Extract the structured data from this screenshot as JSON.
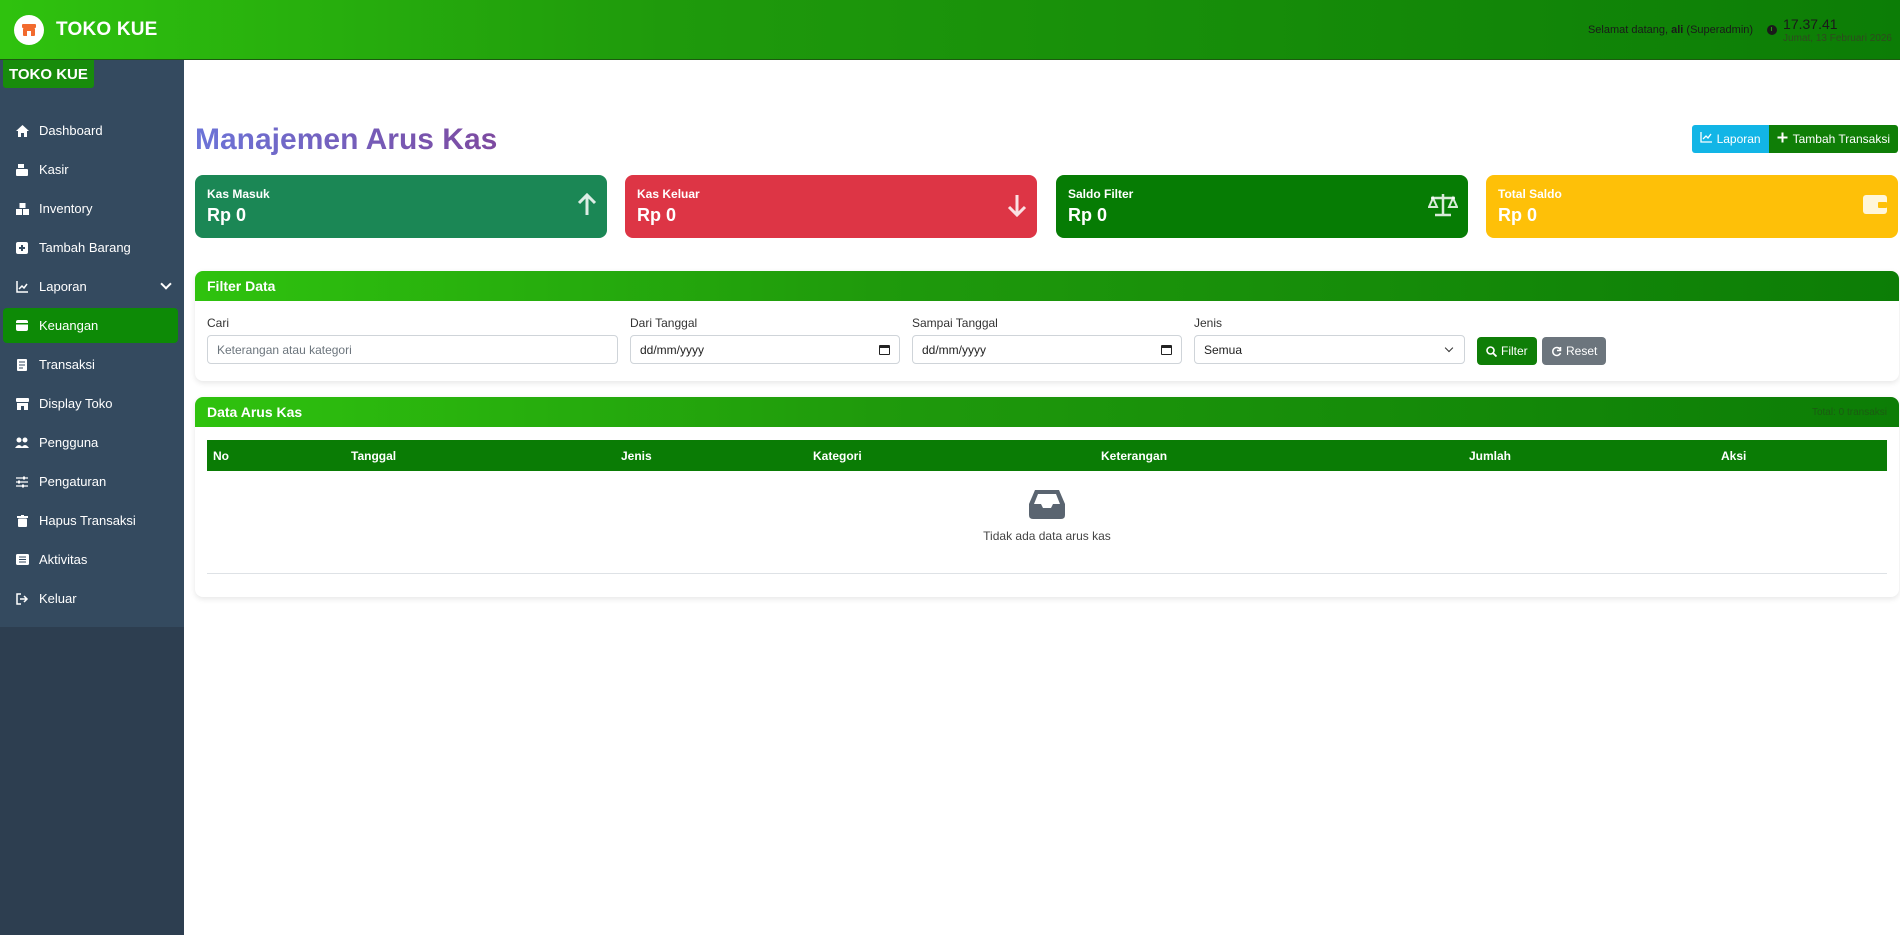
{
  "app": {
    "brand": "TOKO KUE",
    "sidebar_brand": "TOKO KUE"
  },
  "header": {
    "welcome_prefix": "Selamat datang, ",
    "user": "ali",
    "role": "(Superadmin)",
    "time": "17.37.41",
    "date": "Jumat, 13 Februari 2026"
  },
  "sidebar": {
    "items": [
      {
        "label": "Dashboard",
        "icon": "home-icon"
      },
      {
        "label": "Kasir",
        "icon": "cash-register-icon"
      },
      {
        "label": "Inventory",
        "icon": "boxes-icon"
      },
      {
        "label": "Tambah Barang",
        "icon": "plus-square-icon"
      },
      {
        "label": "Laporan",
        "icon": "chart-line-icon"
      },
      {
        "label": "Keuangan",
        "icon": "wallet-icon"
      },
      {
        "label": "Transaksi",
        "icon": "receipt-icon"
      },
      {
        "label": "Display Toko",
        "icon": "store-icon"
      },
      {
        "label": "Pengguna",
        "icon": "users-icon"
      },
      {
        "label": "Pengaturan",
        "icon": "sliders-icon"
      },
      {
        "label": "Hapus Transaksi",
        "icon": "trash-icon"
      },
      {
        "label": "Aktivitas",
        "icon": "list-icon"
      },
      {
        "label": "Keluar",
        "icon": "sign-out-icon"
      }
    ],
    "active": "Keuangan"
  },
  "page": {
    "title": "Manajemen Arus Kas",
    "btn_laporan": "Laporan",
    "btn_tambah": "Tambah Transaksi"
  },
  "stats": [
    {
      "label": "Kas Masuk",
      "value": "Rp 0",
      "color": "#1b8755",
      "icon": "arrow-up-icon"
    },
    {
      "label": "Kas Keluar",
      "value": "Rp 0",
      "color": "#dd3545",
      "icon": "arrow-down-icon"
    },
    {
      "label": "Saldo Filter",
      "value": "Rp 0",
      "color": "#067c04",
      "icon": "balance-scale-icon"
    },
    {
      "label": "Total Saldo",
      "value": "Rp 0",
      "color": "#fec008",
      "icon": "wallet-icon"
    }
  ],
  "filter": {
    "title": "Filter Data",
    "cari_label": "Cari",
    "cari_placeholder": "Keterangan atau kategori",
    "dari_label": "Dari Tanggal",
    "dari_value": "dd/mm/yyyy",
    "sampai_label": "Sampai Tanggal",
    "sampai_value": "dd/mm/yyyy",
    "jenis_label": "Jenis",
    "jenis_value": "Semua",
    "btn_filter": "Filter",
    "btn_reset": "Reset"
  },
  "table": {
    "title": "Data Arus Kas",
    "total": "Total: 0 transaksi",
    "columns": [
      "No",
      "Tanggal",
      "Jenis",
      "Kategori",
      "Keterangan",
      "Jumlah",
      "Aksi"
    ],
    "empty": "Tidak ada data arus kas"
  },
  "colors": {
    "primary": "#0f7e07",
    "accent": "#12b5e6",
    "sidebar": "#2d3e50"
  }
}
